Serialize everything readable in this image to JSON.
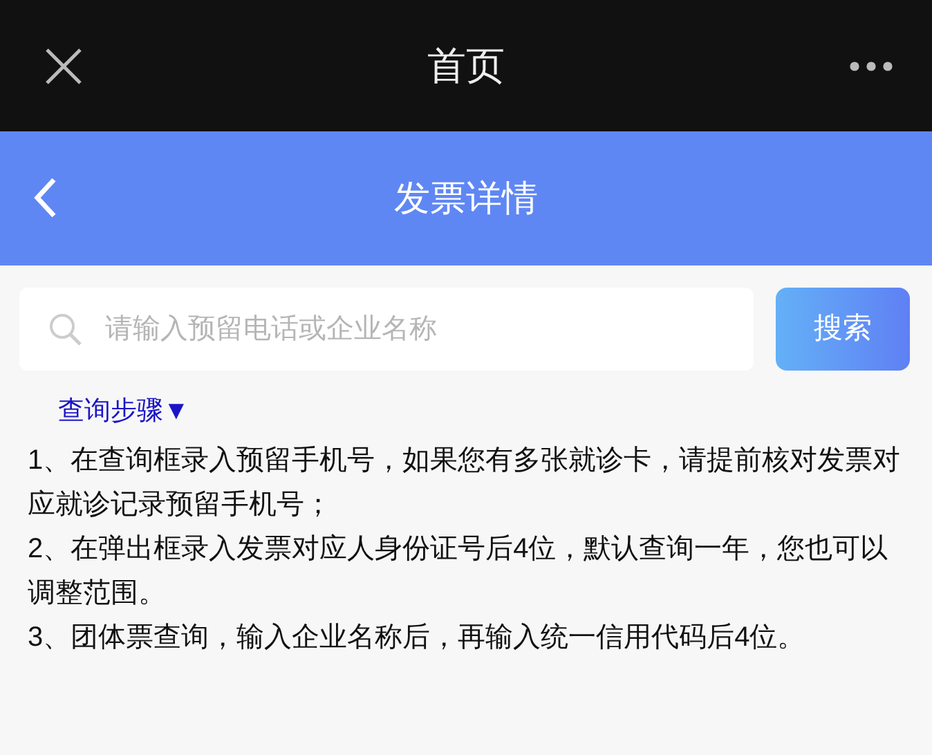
{
  "top_bar": {
    "title": "首页"
  },
  "header": {
    "title": "发票详情"
  },
  "search": {
    "placeholder": "请输入预留电话或企业名称",
    "button": "搜索"
  },
  "steps_toggle": "查询步骤▼",
  "steps": [
    "1、在查询框录入预留手机号，如果您有多张就诊卡，请提前核对发票对应就诊记录预留手机号；",
    "2、在弹出框录入发票对应人身份证号后4位，默认查询一年，您也可以调整范围。",
    "3、团体票查询，输入企业名称后，再输入统一信用代码后4位。"
  ]
}
